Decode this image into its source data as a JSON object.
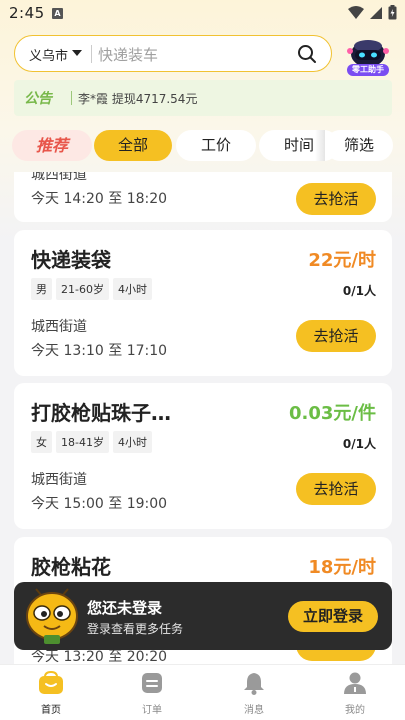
{
  "status_bar": {
    "time": "2:45",
    "notification_icon": "A"
  },
  "search": {
    "city": "义乌市",
    "placeholder": "快递装车"
  },
  "assistant": {
    "label": "零工助手"
  },
  "notice": {
    "tag": "公告",
    "text": "李*霞 提现4717.54元"
  },
  "tabs": [
    {
      "label": "推荐"
    },
    {
      "label": "全部"
    },
    {
      "label": "工价"
    },
    {
      "label": "时间"
    },
    {
      "label": "筛选"
    }
  ],
  "jobs": [
    {
      "title": "",
      "pay": "",
      "tags": [],
      "count": "",
      "location": "城西街道",
      "time": "今天 14:20 至 18:20",
      "action": "去抢活"
    },
    {
      "title": "快递装袋",
      "pay": "22元/时",
      "tags": [
        "男",
        "21-60岁",
        "4小时"
      ],
      "count": "0/1人",
      "location": "城西街道",
      "time": "今天 13:10 至 17:10",
      "action": "去抢活"
    },
    {
      "title": "打胶枪贴珠子…",
      "pay": "0.03元/件",
      "tags": [
        "女",
        "18-41岁",
        "4小时"
      ],
      "count": "0/1人",
      "location": "城西街道",
      "time": "今天 15:00 至 19:00",
      "action": "去抢活"
    },
    {
      "title": "胶枪粘花",
      "pay": "18元/时",
      "tags": [],
      "count": "",
      "location": "",
      "time": "今天 13:20 至 20:20",
      "action": ""
    }
  ],
  "login_banner": {
    "title": "您还未登录",
    "subtitle": "登录查看更多任务",
    "button": "立即登录"
  },
  "bottom_nav": [
    {
      "label": "首页",
      "icon": "home-bag-icon"
    },
    {
      "label": "订单",
      "icon": "order-icon"
    },
    {
      "label": "消息",
      "icon": "bell-icon"
    },
    {
      "label": "我的",
      "icon": "profile-icon"
    }
  ],
  "colors": {
    "accent": "#f5c022",
    "pay_orange": "#f08a24",
    "pay_green": "#6bbd45",
    "notice_green": "#78b84a"
  }
}
